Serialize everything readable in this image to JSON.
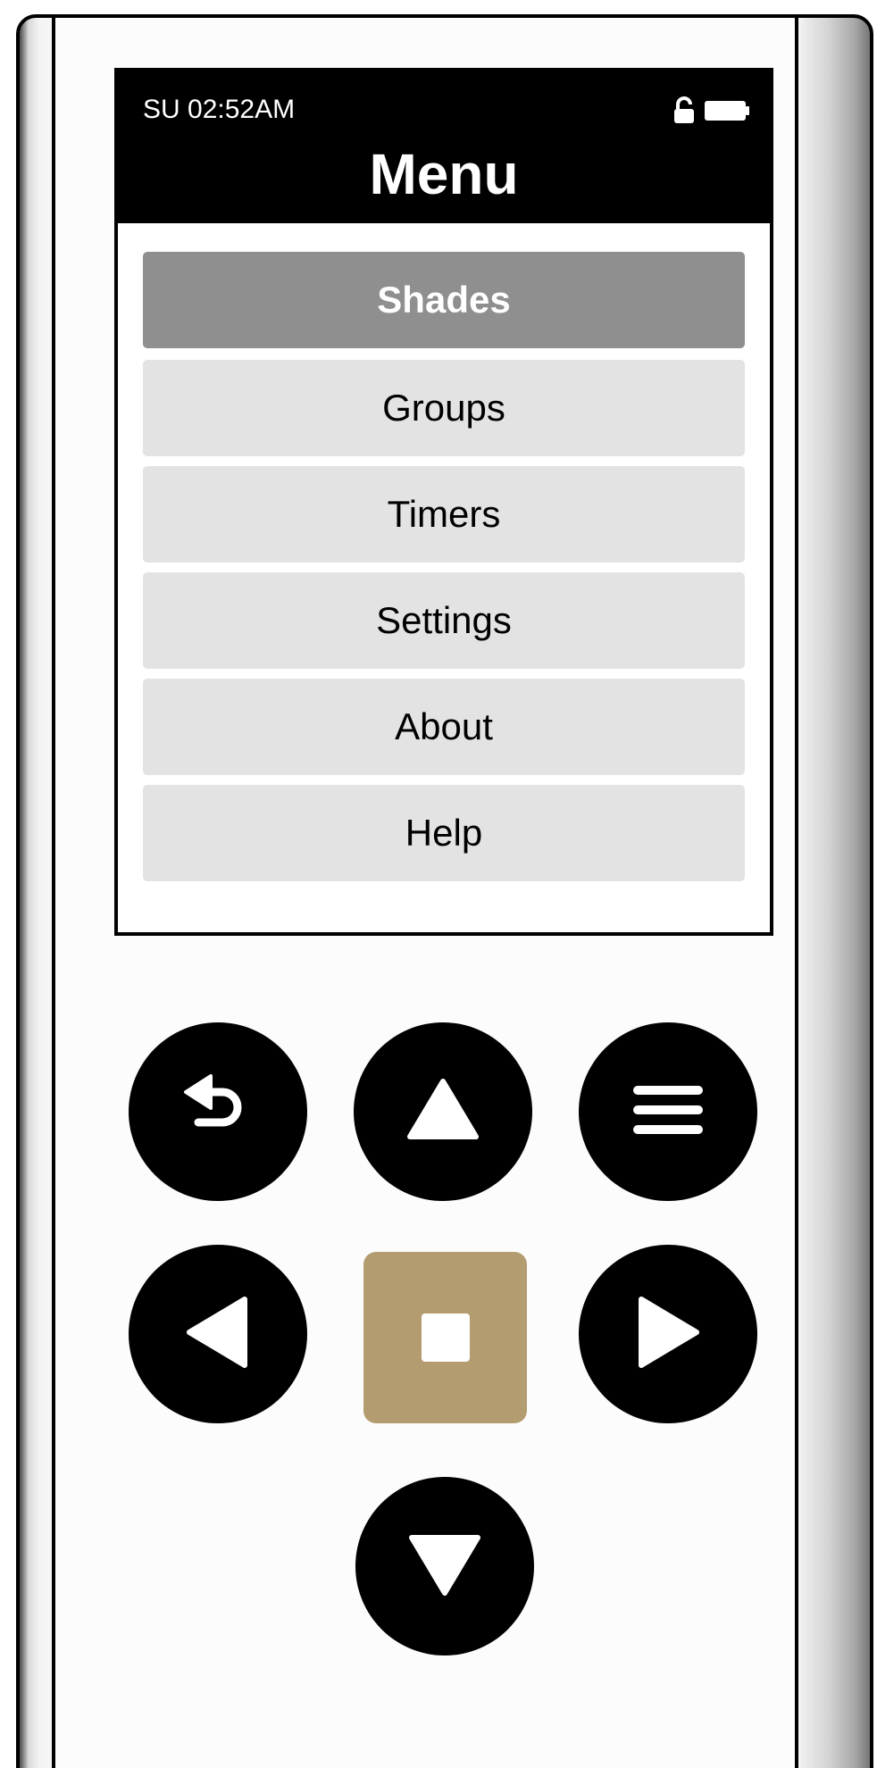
{
  "status": {
    "time": "SU 02:52AM",
    "icons": [
      "unlock-icon",
      "battery-icon"
    ]
  },
  "screen": {
    "title": "Menu"
  },
  "menu": {
    "selected": "Shades",
    "items": [
      {
        "label": "Shades"
      },
      {
        "label": "Groups"
      },
      {
        "label": "Timers"
      },
      {
        "label": "Settings"
      },
      {
        "label": "About"
      },
      {
        "label": "Help"
      }
    ]
  },
  "controls": {
    "icons": [
      "back-icon",
      "up-arrow-icon",
      "menu-icon",
      "left-arrow-icon",
      "stop-icon",
      "right-arrow-icon",
      "down-arrow-icon"
    ]
  },
  "colors": {
    "header_bg": "#000000",
    "selected_item_bg": "#8f8f8f",
    "item_bg": "#e3e3e3",
    "button_bg": "#000000",
    "center_button_bg": "#b39d70"
  }
}
